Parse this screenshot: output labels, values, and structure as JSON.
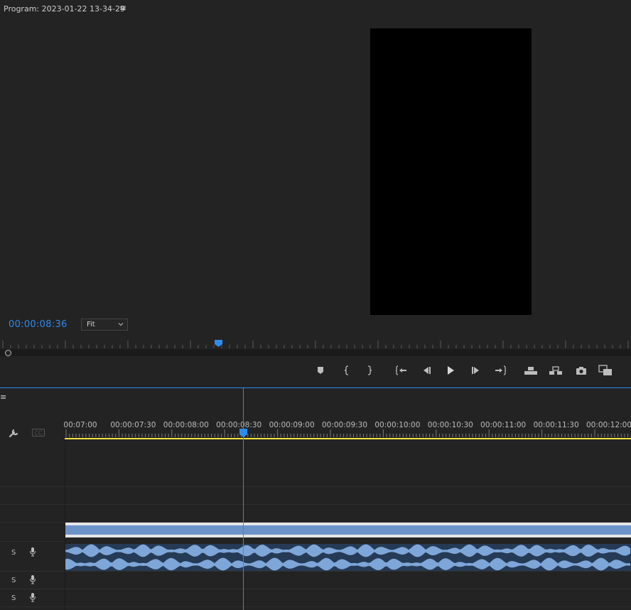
{
  "program_monitor": {
    "title": "Program: 2023-01-22 13-34-29",
    "menu_icon": "≡",
    "timecode": "00:00:08:36",
    "zoom_select": "Fit"
  },
  "transport": [
    {
      "name": "add-marker-button",
      "icon": "marker-icon"
    },
    {
      "name": "mark-in-button",
      "icon": "mark-in-icon"
    },
    {
      "name": "mark-out-button",
      "icon": "mark-out-icon"
    },
    {
      "name": "go-to-in-button",
      "icon": "go-to-in-icon"
    },
    {
      "name": "step-back-button",
      "icon": "step-back-icon"
    },
    {
      "name": "play-button",
      "icon": "play-icon"
    },
    {
      "name": "step-forward-button",
      "icon": "step-forward-icon"
    },
    {
      "name": "go-to-out-button",
      "icon": "go-to-out-icon"
    },
    {
      "name": "lift-button",
      "icon": "lift-icon"
    },
    {
      "name": "extract-button",
      "icon": "extract-icon"
    },
    {
      "name": "export-frame-button",
      "icon": "camera-icon"
    },
    {
      "name": "compare-view-button",
      "icon": "compare-icon"
    }
  ],
  "timeline": {
    "menu_icon": "≡",
    "ruler_labels": [
      "00:07:00",
      "00:00:07:30",
      "00:00:08:00",
      "00:00:08:30",
      "00:00:09:00",
      "00:00:09:30",
      "00:00:10:00",
      "00:00:10:30",
      "00:00:11:00",
      "00:00:11:30",
      "00:00:12:00"
    ],
    "audio_tracks": [
      {
        "solo": "S"
      },
      {
        "solo": "S"
      },
      {
        "solo": "S"
      }
    ]
  },
  "colors": {
    "accent": "#2d8ceb",
    "work_area": "#f1e33a",
    "video_clip": "#6b93c7",
    "audio_clip": "#253a55",
    "waveform": "#7fa6d8"
  }
}
